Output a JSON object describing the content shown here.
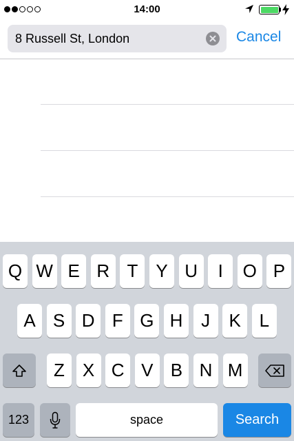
{
  "status_bar": {
    "signal_filled": 2,
    "signal_total": 5,
    "time": "14:00",
    "battery_level": 1.0
  },
  "search": {
    "value": "8 Russell St, London",
    "cancel_label": "Cancel"
  },
  "results": {
    "row_count": 3
  },
  "keyboard": {
    "row1": [
      "Q",
      "W",
      "E",
      "R",
      "T",
      "Y",
      "U",
      "I",
      "O",
      "P"
    ],
    "row2": [
      "A",
      "S",
      "D",
      "F",
      "G",
      "H",
      "J",
      "K",
      "L"
    ],
    "row3": [
      "Z",
      "X",
      "C",
      "V",
      "B",
      "N",
      "M"
    ],
    "numbers_label": "123",
    "space_label": "space",
    "search_label": "Search"
  },
  "colors": {
    "accent": "#1a87e5",
    "battery": "#4cd964",
    "keyboard_bg": "#d1d5db"
  }
}
